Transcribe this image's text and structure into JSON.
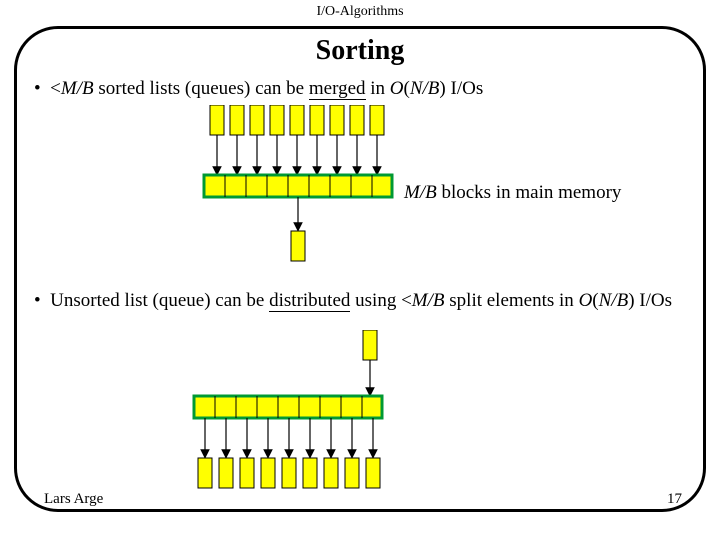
{
  "header": "I/O-Algorithms",
  "title": "Sorting",
  "bullet1": {
    "dot": "•",
    "prefix": "<",
    "mb": "M/B",
    "mid1": " sorted lists (queues) can be ",
    "merged": "merged",
    "mid2": " in ",
    "o": "O",
    "paren1": "(",
    "nb": "N/B",
    "paren2": ") I/Os"
  },
  "memlabel": {
    "mb": "M/B",
    "rest": " blocks in main memory"
  },
  "bullet2": {
    "dot": "•",
    "t1": "Unsorted list (queue) can be ",
    "distributed": "distributed",
    "t2": " using <",
    "mb": "M/B",
    "t3": " split elements in ",
    "o": "O",
    "paren1": "(",
    "nb": "N/B",
    "paren2": ") I/Os"
  },
  "footer": {
    "author": "Lars Arge",
    "page": "17"
  },
  "chart_data": [
    {
      "type": "diagram",
      "name": "merge",
      "top_blocks": 9,
      "arrows_into_bar": 9,
      "memory_bar_cells": 9,
      "output_block": 1
    },
    {
      "type": "diagram",
      "name": "distribute",
      "input_block": 1,
      "memory_bar_cells": 9,
      "arrows_out": 9,
      "bottom_blocks": 9
    }
  ]
}
